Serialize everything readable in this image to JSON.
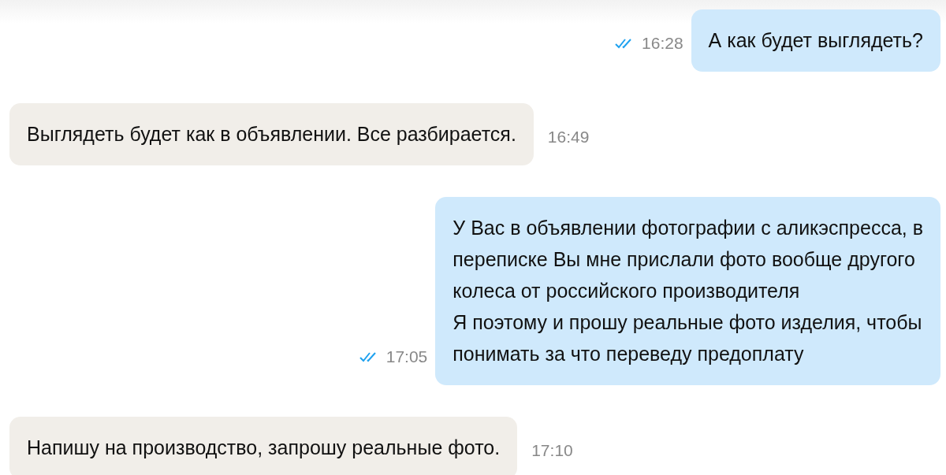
{
  "messages": [
    {
      "kind": "outgoing",
      "text": "А как будет выглядеть?",
      "time": "16:28",
      "read": true
    },
    {
      "kind": "incoming",
      "text": "Выглядеть будет как в объявлении. Все разбирается.",
      "time": "16:49"
    },
    {
      "kind": "outgoing",
      "text": "У Вас в объявлении фотографии с аликэспресса, в\nпереписке Вы мне прислали фото вообще другого\nколеса от российского производителя\nЯ поэтому и прошу реальные фото изделия, чтобы\nпонимать за что переведу предоплату",
      "time": "17:05",
      "read": true
    },
    {
      "kind": "incoming",
      "text": "Напишу на производство, запрошу реальные фото.",
      "time": "17:10"
    }
  ]
}
